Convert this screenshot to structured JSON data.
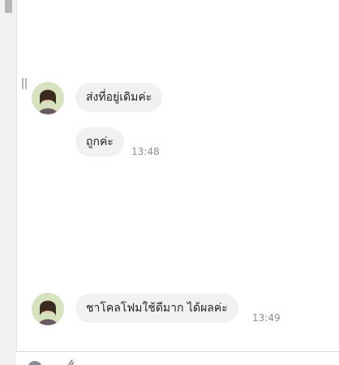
{
  "conversation": {
    "messages": [
      {
        "text": "ส่งที่อยู่เดิมค่ะ",
        "time": ""
      },
      {
        "text": "ถูกค่ะ",
        "time": "13:48"
      },
      {
        "text": "ชาโคลโฟมใช้ดีมาก ได้ผลค่ะ",
        "time": "13:49"
      }
    ]
  },
  "icons": {
    "avatar": "user-avatar",
    "emoji": "emoji-icon",
    "attach": "paperclip-icon"
  }
}
